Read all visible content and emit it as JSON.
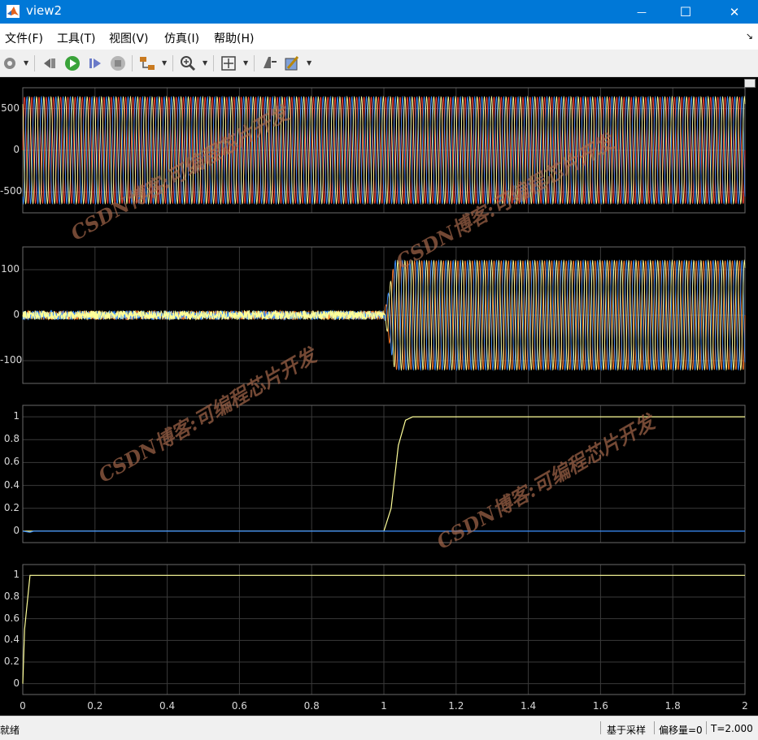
{
  "window": {
    "title": "view2",
    "minimize_symbol": "—",
    "maximize_symbol": "☐",
    "close_symbol": "✕"
  },
  "menu": {
    "items": [
      "文件(F)",
      "工具(T)",
      "视图(V)",
      "仿真(I)",
      "帮助(H)"
    ],
    "pin_symbol": "↘"
  },
  "toolbar": {
    "icons": [
      "settings-icon",
      "step-back-icon",
      "run-icon",
      "step-forward-icon",
      "stop-icon",
      "signal-select-icon",
      "zoom-icon",
      "autoscale-icon",
      "cursor-measure-icon",
      "style-icon"
    ]
  },
  "colors": {
    "titlebar": "#0078d7",
    "plot_background": "#000000",
    "axes_background": "#000000",
    "axes_border": "#6a6a6a",
    "grid": "#3a3a3a",
    "series_yellow": "#ffff99",
    "series_blue": "#3a8fff",
    "series_red": "#ff4433",
    "series_orange": "#ff7a2a",
    "watermark": "#b06e50"
  },
  "chart_data": [
    {
      "type": "line",
      "panel": 1,
      "yticks": [
        "500",
        "0",
        "-500"
      ],
      "ylim": [
        -750,
        750
      ],
      "xlim": [
        0,
        2
      ],
      "grid": true,
      "series": [
        {
          "color": "#ff4433",
          "amplitude": 640,
          "frequency_hz": 50,
          "phase_deg": 0
        },
        {
          "color": "#3a8fff",
          "amplitude": 640,
          "frequency_hz": 50,
          "phase_deg": -120
        },
        {
          "color": "#ffff99",
          "amplitude": 640,
          "frequency_hz": 50,
          "phase_deg": 120
        }
      ]
    },
    {
      "type": "line",
      "panel": 2,
      "yticks": [
        "100",
        "0",
        "-100"
      ],
      "ylim": [
        -150,
        150
      ],
      "xlim": [
        0,
        2
      ],
      "grid": true,
      "noise_before_t": 1.0,
      "noise_amplitude": 10,
      "steady_amplitude": 120,
      "series": [
        {
          "color": "#ff7a2a",
          "phase_deg": 0
        },
        {
          "color": "#3a8fff",
          "phase_deg": -120
        },
        {
          "color": "#ffff99",
          "phase_deg": 120
        }
      ]
    },
    {
      "type": "line",
      "panel": 3,
      "yticks": [
        "1",
        "0.8",
        "0.6",
        "0.4",
        "0.2",
        "0"
      ],
      "ylim": [
        -0.1,
        1.1
      ],
      "xlim": [
        0,
        2
      ],
      "grid": true,
      "series": [
        {
          "color": "#ffff99",
          "points": [
            [
              0,
              0
            ],
            [
              1.0,
              0
            ],
            [
              1.02,
              0.2
            ],
            [
              1.04,
              0.75
            ],
            [
              1.06,
              0.97
            ],
            [
              1.08,
              1.0
            ],
            [
              2.0,
              1.0
            ]
          ]
        },
        {
          "color": "#3a8fff",
          "points": [
            [
              0,
              0
            ],
            [
              0.02,
              -0.01
            ],
            [
              0.03,
              0
            ],
            [
              2.0,
              0
            ]
          ]
        }
      ]
    },
    {
      "type": "line",
      "panel": 4,
      "yticks": [
        "1",
        "0.8",
        "0.6",
        "0.4",
        "0.2",
        "0"
      ],
      "ylim": [
        -0.1,
        1.1
      ],
      "xlim": [
        0,
        2
      ],
      "xticks": [
        "0",
        "0.2",
        "0.4",
        "0.6",
        "0.8",
        "1",
        "1.2",
        "1.4",
        "1.6",
        "1.8",
        "2"
      ],
      "grid": true,
      "series": [
        {
          "color": "#ffff99",
          "points": [
            [
              0,
              0
            ],
            [
              0.005,
              0.5
            ],
            [
              0.02,
              1.0
            ],
            [
              2.0,
              1.0
            ]
          ]
        }
      ]
    }
  ],
  "watermarks": [
    "CSDN博客:可编程芯片开发",
    "CSDN博客:可编程芯片开发",
    "CSDN博客:可编程芯片开发",
    "CSDN博客:可编程芯片开发"
  ],
  "status": {
    "left": "就绪",
    "sample_based": "基于采样",
    "offset": "偏移量=0",
    "time": "T=2.000"
  }
}
